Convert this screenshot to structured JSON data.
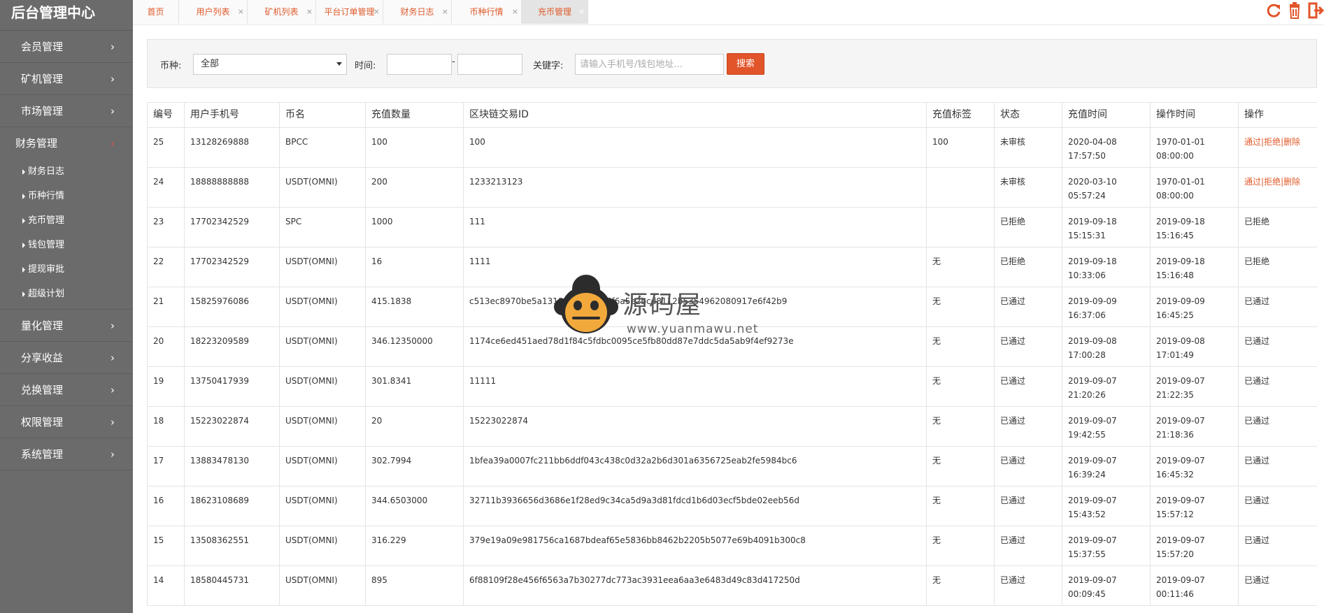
{
  "sidebar": {
    "title": "后台管理中心",
    "items": [
      {
        "label": "会员管理",
        "name": "sidebar-item-members"
      },
      {
        "label": "矿机管理",
        "name": "sidebar-item-miners"
      },
      {
        "label": "市场管理",
        "name": "sidebar-item-market"
      }
    ],
    "open_item": {
      "label": "财务管理"
    },
    "sub_items": [
      {
        "label": "财务日志"
      },
      {
        "label": "币种行情"
      },
      {
        "label": "充币管理"
      },
      {
        "label": "钱包管理"
      },
      {
        "label": "提现审批"
      },
      {
        "label": "超级计划"
      }
    ],
    "items_after": [
      {
        "label": "量化管理",
        "name": "sidebar-item-quant"
      },
      {
        "label": "分享收益",
        "name": "sidebar-item-share"
      },
      {
        "label": "兑换管理",
        "name": "sidebar-item-exchange"
      },
      {
        "label": "权限管理",
        "name": "sidebar-item-permissions"
      },
      {
        "label": "系统管理",
        "name": "sidebar-item-system"
      }
    ]
  },
  "tabs": [
    {
      "label": "首页",
      "closable": false
    },
    {
      "label": "用户列表",
      "closable": true
    },
    {
      "label": "矿机列表",
      "closable": true
    },
    {
      "label": "平台订单管理",
      "closable": true
    },
    {
      "label": "财务日志",
      "closable": true
    },
    {
      "label": "币种行情",
      "closable": true
    },
    {
      "label": "充币管理",
      "closable": true,
      "active": true
    }
  ],
  "top_icons": [
    "refresh-icon",
    "trash-icon",
    "logout-icon"
  ],
  "search": {
    "coin_label": "币种:",
    "coin_value": "全部",
    "time_label": "时间:",
    "time_sep": "-",
    "keyword_label": "关键字:",
    "keyword_placeholder": "请输入手机号/钱包地址...",
    "search_button": "搜索"
  },
  "table": {
    "headers": [
      "编号",
      "用户手机号",
      "币名",
      "充值数量",
      "区块链交易ID",
      "充值标签",
      "状态",
      "充值时间",
      "操作时间",
      "操作"
    ],
    "actions": {
      "approve": "通过",
      "reject": "拒绝",
      "delete": "删除",
      "sep": "|"
    },
    "rows": [
      {
        "id": "25",
        "phone": "13128269888",
        "coin": "BPCC",
        "amount": "100",
        "txid": "100",
        "tag": "100",
        "status": "未审核",
        "recharge_date": "2020-04-08",
        "recharge_time": "17:57:50",
        "op_date": "1970-01-01",
        "op_time": "08:00:00",
        "op": "",
        "pending": true
      },
      {
        "id": "24",
        "phone": "18888888888",
        "coin": "USDT(OMNI)",
        "amount": "200",
        "txid": "1233213123",
        "tag": "",
        "status": "未审核",
        "recharge_date": "2020-03-10",
        "recharge_time": "05:57:24",
        "op_date": "1970-01-01",
        "op_time": "08:00:00",
        "op": "",
        "pending": true
      },
      {
        "id": "23",
        "phone": "17702342529",
        "coin": "SPC",
        "amount": "1000",
        "txid": "111",
        "tag": "",
        "status": "已拒绝",
        "recharge_date": "2019-09-18",
        "recharge_time": "15:15:31",
        "op_date": "2019-09-18",
        "op_time": "15:16:45",
        "op": "已拒绝",
        "pending": false
      },
      {
        "id": "22",
        "phone": "17702342529",
        "coin": "USDT(OMNI)",
        "amount": "16",
        "txid": "1111",
        "tag": "无",
        "status": "已拒绝",
        "recharge_date": "2019-09-18",
        "recharge_time": "10:33:06",
        "op_date": "2019-09-18",
        "op_time": "15:16:48",
        "op": "已拒绝",
        "pending": false
      },
      {
        "id": "21",
        "phone": "15825976086",
        "coin": "USDT(OMNI)",
        "amount": "415.1838",
        "txid": "c513ec8970be5a1318f08a3bdef5f6a5e2bcd8112b5354962080917e6f42b9",
        "tag": "无",
        "status": "已通过",
        "recharge_date": "2019-09-09",
        "recharge_time": "16:37:06",
        "op_date": "2019-09-09",
        "op_time": "16:45:25",
        "op": "已通过",
        "pending": false
      },
      {
        "id": "20",
        "phone": "18223209589",
        "coin": "USDT(OMNI)",
        "amount": "346.12350000",
        "txid": "1174ce6ed451aed78d1f84c5fdbc0095ce5fb80dd87e7ddc5da5ab9f4ef9273e",
        "tag": "无",
        "status": "已通过",
        "recharge_date": "2019-09-08",
        "recharge_time": "17:00:28",
        "op_date": "2019-09-08",
        "op_time": "17:01:49",
        "op": "已通过",
        "pending": false
      },
      {
        "id": "19",
        "phone": "13750417939",
        "coin": "USDT(OMNI)",
        "amount": "301.8341",
        "txid": "11111",
        "tag": "无",
        "status": "已通过",
        "recharge_date": "2019-09-07",
        "recharge_time": "21:20:26",
        "op_date": "2019-09-07",
        "op_time": "21:22:35",
        "op": "已通过",
        "pending": false
      },
      {
        "id": "18",
        "phone": "15223022874",
        "coin": "USDT(OMNI)",
        "amount": "20",
        "txid": "15223022874",
        "tag": "无",
        "status": "已通过",
        "recharge_date": "2019-09-07",
        "recharge_time": "19:42:55",
        "op_date": "2019-09-07",
        "op_time": "21:18:36",
        "op": "已通过",
        "pending": false
      },
      {
        "id": "17",
        "phone": "13883478130",
        "coin": "USDT(OMNI)",
        "amount": "302.7994",
        "txid": "1bfea39a0007fc211bb6ddf043c438c0d32a2b6d301a6356725eab2fe5984bc6",
        "tag": "无",
        "status": "已通过",
        "recharge_date": "2019-09-07",
        "recharge_time": "16:39:24",
        "op_date": "2019-09-07",
        "op_time": "16:45:32",
        "op": "已通过",
        "pending": false
      },
      {
        "id": "16",
        "phone": "18623108689",
        "coin": "USDT(OMNI)",
        "amount": "344.6503000",
        "txid": "32711b3936656d3686e1f28ed9c34ca5d9a3d81fdcd1b6d03ecf5bde02eeb56d",
        "tag": "无",
        "status": "已通过",
        "recharge_date": "2019-09-07",
        "recharge_time": "15:43:52",
        "op_date": "2019-09-07",
        "op_time": "15:57:12",
        "op": "已通过",
        "pending": false
      },
      {
        "id": "15",
        "phone": "13508362551",
        "coin": "USDT(OMNI)",
        "amount": "316.229",
        "txid": "379e19a09e981756ca1687bdeaf65e5836bb8462b2205b5077e69b4091b300c8",
        "tag": "无",
        "status": "已通过",
        "recharge_date": "2019-09-07",
        "recharge_time": "15:37:55",
        "op_date": "2019-09-07",
        "op_time": "15:57:20",
        "op": "已通过",
        "pending": false
      },
      {
        "id": "14",
        "phone": "18580445731",
        "coin": "USDT(OMNI)",
        "amount": "895",
        "txid": "6f88109f28e456f6563a7b30277dc773ac3931eea6aa3e6483d49c83d417250d",
        "tag": "无",
        "status": "已通过",
        "recharge_date": "2019-09-07",
        "recharge_time": "00:09:45",
        "op_date": "2019-09-07",
        "op_time": "00:11:46",
        "op": "已通过",
        "pending": false
      }
    ]
  },
  "watermark": {
    "text": "源码屋",
    "url": "www.yuanmawu.net"
  },
  "colors": {
    "accent": "#e2542a",
    "sidebar_bg": "#6b6b6b"
  }
}
